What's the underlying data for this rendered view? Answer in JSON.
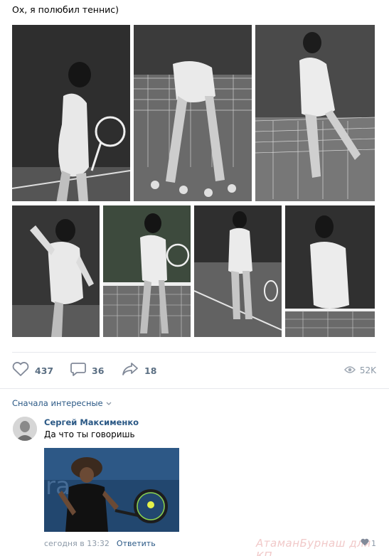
{
  "post": {
    "text": "Ох, я полюбил теннис)",
    "photos": [
      "tennis-photo-1",
      "tennis-photo-2",
      "tennis-photo-3",
      "tennis-photo-4",
      "tennis-photo-5",
      "tennis-photo-6",
      "tennis-photo-7"
    ]
  },
  "actions": {
    "likes": "437",
    "comments": "36",
    "shares": "18",
    "views": "52K"
  },
  "comments_section": {
    "sort_label": "Сначала интересные"
  },
  "comment": {
    "author": "Сергей Максименко",
    "text": "Да что ты говоришь",
    "time": "сегодня в 13:32",
    "reply_label": "Ответить",
    "likes": "1"
  },
  "watermark": "АтаманБурнаш для КП",
  "colors": {
    "link": "#2a5885",
    "muted": "#8c99a7",
    "action": "#5b6f83",
    "divider": "#e7e8ec"
  }
}
